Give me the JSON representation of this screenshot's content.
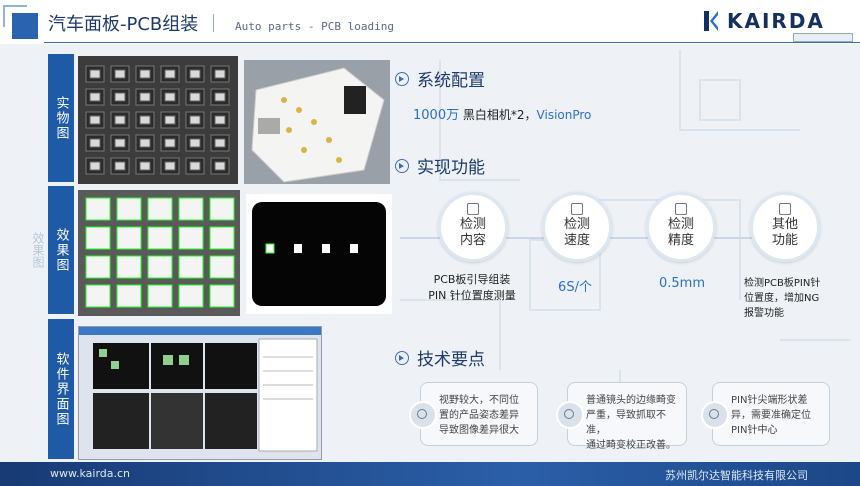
{
  "header": {
    "title": "汽车面板-PCB组装",
    "subtitle": "Auto parts - PCB loading",
    "logo_text": "KAIRDA"
  },
  "left": {
    "labels": [
      "实物图",
      "效果图",
      "软件界面图"
    ],
    "ghost_label": "效果图"
  },
  "config": {
    "heading": "系统配置",
    "camera_res": "1000万",
    "camera_desc": " 黑白相机*2，",
    "software": "VisionPro"
  },
  "functions": {
    "heading": "实现功能",
    "items": [
      {
        "label_line1": "检测",
        "label_line2": "内容",
        "icon": "document-icon",
        "value_line1": "PCB板引导组装",
        "value_line2": "PIN 针位置度测量"
      },
      {
        "label_line1": "检测",
        "label_line2": "速度",
        "icon": "rocket-icon",
        "value_line1": "6S/个",
        "value_line2": ""
      },
      {
        "label_line1": "检测",
        "label_line2": "精度",
        "icon": "ruler-icon",
        "value_line1": "0.5mm",
        "value_line2": ""
      },
      {
        "label_line1": "其他",
        "label_line2": "功能",
        "icon": "cube-icon",
        "value_line1": "检测PCB板PIN针",
        "value_line2": "位置度，增加NG",
        "value_line3": "报警功能"
      }
    ]
  },
  "tech": {
    "heading": "技术要点",
    "tips": [
      {
        "icon": "search-icon",
        "lines": [
          "视野较大，不同位",
          "置的产品姿态差异",
          "导致图像差异很大"
        ]
      },
      {
        "icon": "target-icon",
        "lines": [
          "普通镜头的边缘畸变",
          "严重，导致抓取不准，",
          "通过畸变校正改善。"
        ]
      },
      {
        "icon": "wrench-icon",
        "lines": [
          "PIN针尖端形状差",
          "异，需要准确定位",
          "PIN针中心"
        ]
      }
    ]
  },
  "footer": {
    "url": "www.kairda.cn",
    "company": "苏州凯尔达智能科技有限公司"
  },
  "colors": {
    "accent": "#1f5aa6",
    "title": "#1d3a6b",
    "footer": "#2b5fa8"
  }
}
